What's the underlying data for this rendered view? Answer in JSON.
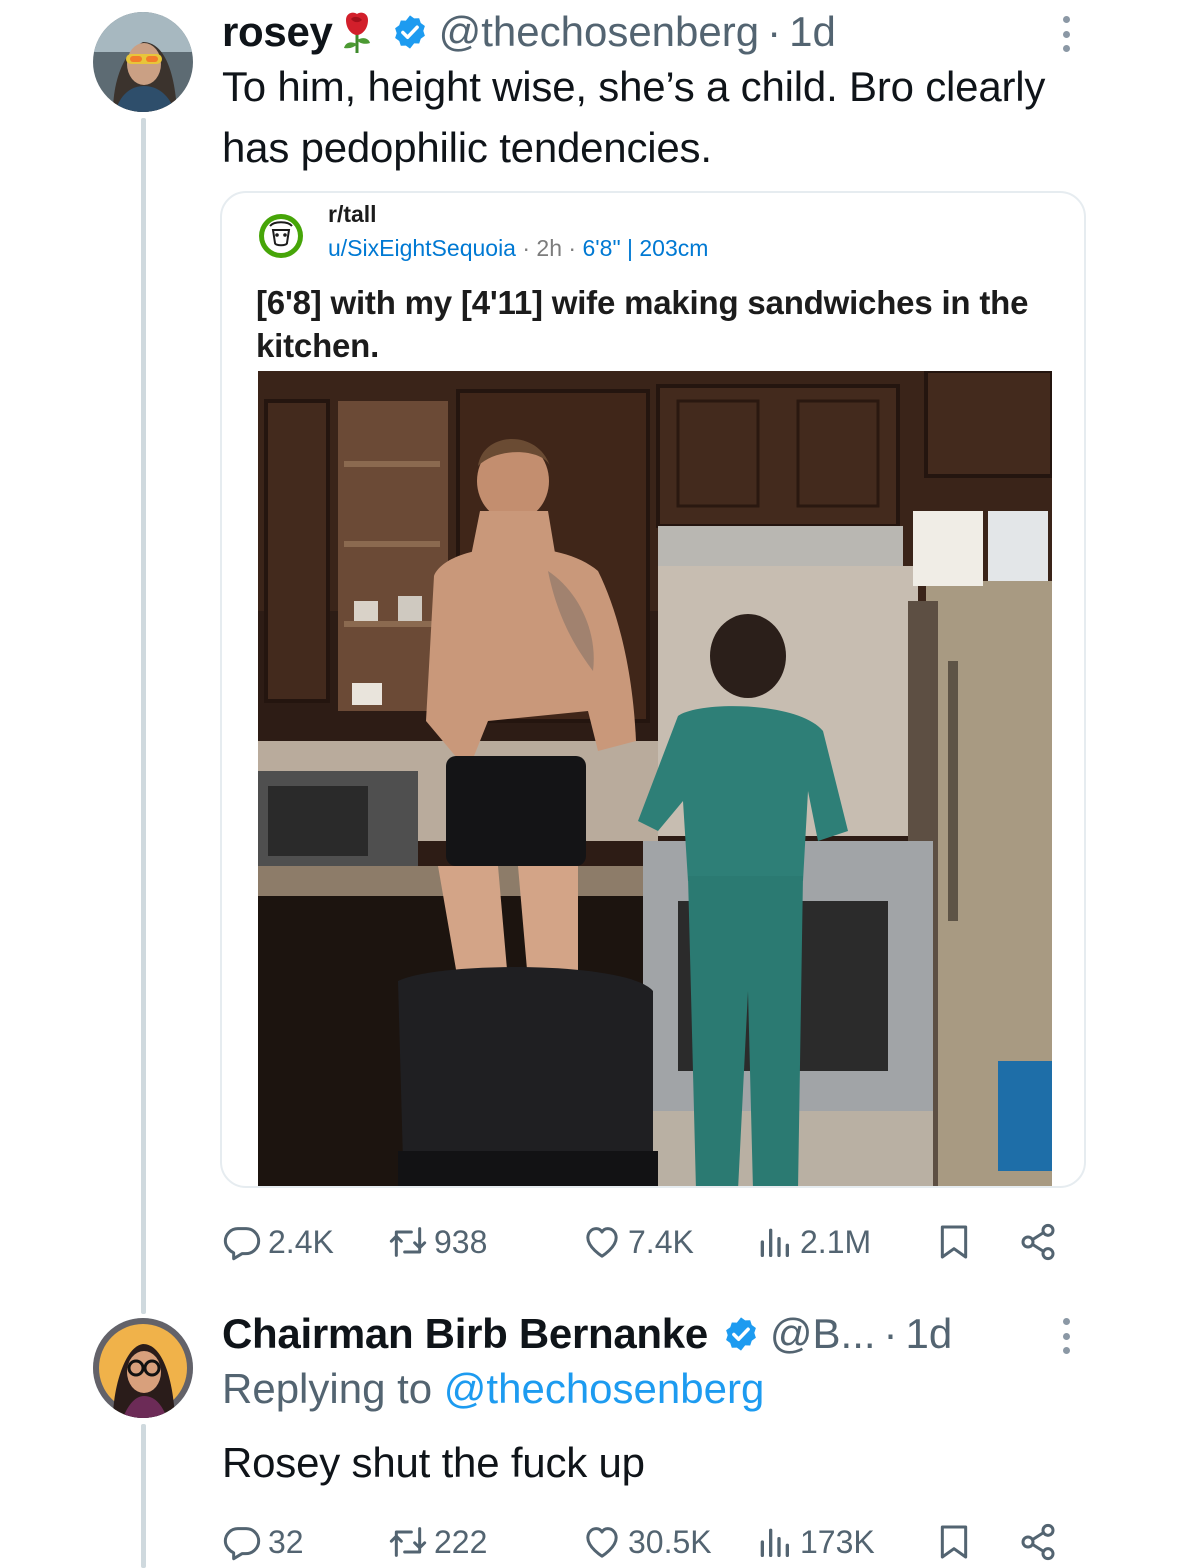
{
  "tweet1": {
    "name": "rosey",
    "name_emoji": "rose",
    "verified": true,
    "handle": "@thechosenberg",
    "separator": "·",
    "time": "1d",
    "text": "To him, height wise, she’s a child.  Bro clearly has pedophilic tendencies.",
    "quote": {
      "subreddit": "r/tall",
      "author": "u/SixEightSequoia",
      "meta_sep": "·",
      "age": "2h",
      "flair": "6'8\" | 203cm",
      "title": "[6'8] with my [4'11] wife making sandwiches in the kitchen.",
      "image": "kitchen photo of a tall tattooed man in black briefs next to a short woman in teal scrubs"
    },
    "actions": {
      "replies": "2.4K",
      "reposts": "938",
      "likes": "7.4K",
      "views": "2.1M"
    }
  },
  "tweet2": {
    "name": "Chairman Birb Bernanke",
    "verified": true,
    "handle": "@B...",
    "separator": "·",
    "time": "1d",
    "replying_label": "Replying to",
    "replying_handle": "@thechosenberg",
    "text": "Rosey shut the fuck up",
    "actions": {
      "replies": "32",
      "reposts": "222",
      "likes": "30.5K",
      "views": "173K"
    }
  },
  "icons": {
    "reply": "reply-icon",
    "repost": "repost-icon",
    "like": "heart-icon",
    "views": "views-icon",
    "bookmark": "bookmark-icon",
    "share": "share-icon",
    "more": "more-icon",
    "verified": "verified-badge-icon"
  },
  "colors": {
    "text": "#0f1419",
    "secondary": "#536471",
    "link": "#1d9bf0",
    "thread_line": "#cfd9de",
    "reddit_meta": "#0079d3"
  }
}
